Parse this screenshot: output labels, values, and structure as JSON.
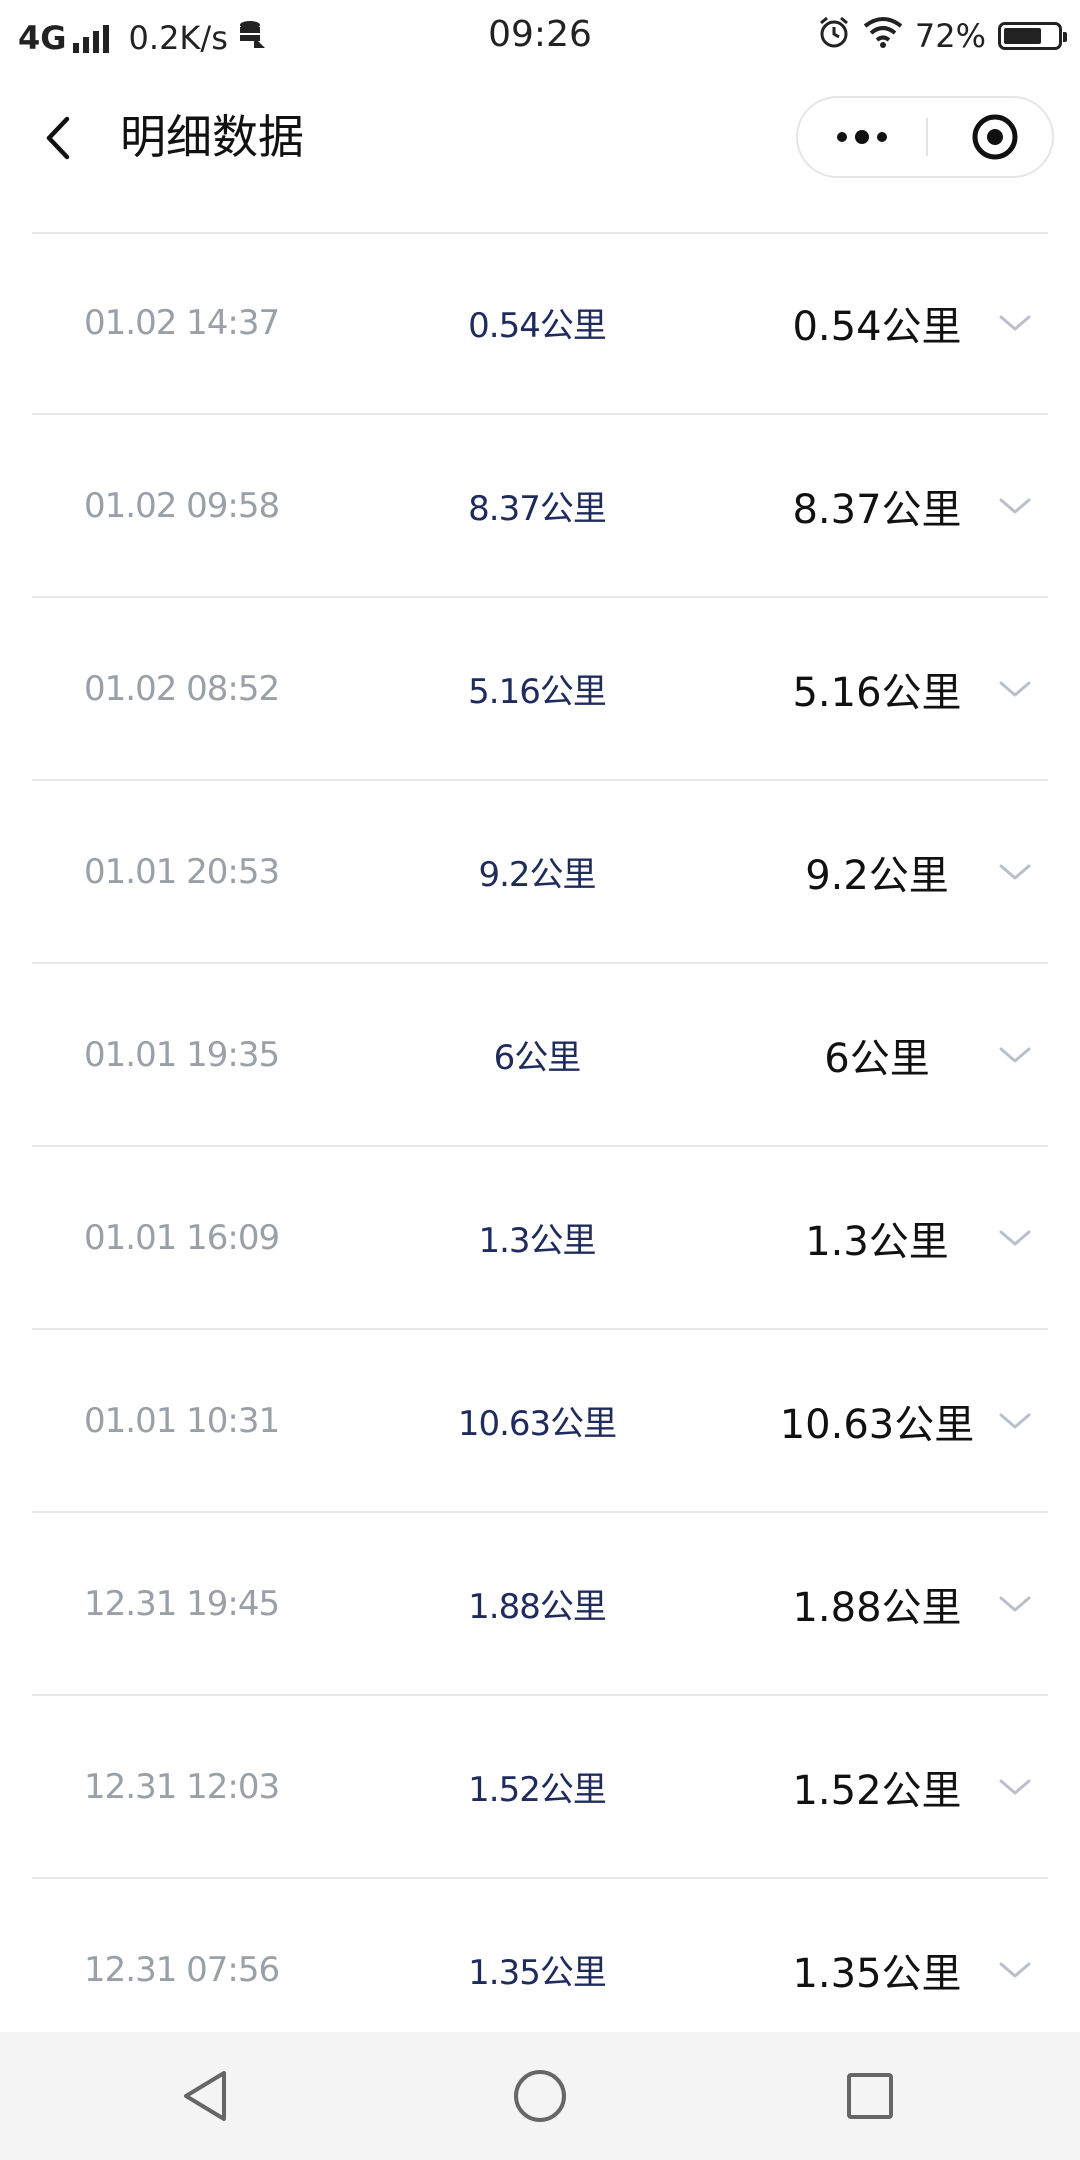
{
  "status_bar": {
    "network": "4G",
    "speed": "0.2K/s",
    "time": "09:26",
    "battery_text": "72%",
    "battery_level": 0.72,
    "icons": [
      "signal-icon",
      "data-icon",
      "alarm-icon",
      "wifi-icon",
      "battery-icon"
    ]
  },
  "nav": {
    "title": "明细数据",
    "back_icon": "chevron-left-icon",
    "more_icon": "more-dots-icon",
    "close_icon": "target-circle-icon"
  },
  "records": [
    {
      "time": "01.02 14:37",
      "distance": "0.54公里",
      "distance_detail": "0.54公里"
    },
    {
      "time": "01.02 09:58",
      "distance": "8.37公里",
      "distance_detail": "8.37公里"
    },
    {
      "time": "01.02 08:52",
      "distance": "5.16公里",
      "distance_detail": "5.16公里"
    },
    {
      "time": "01.01 20:53",
      "distance": "9.2公里",
      "distance_detail": "9.2公里"
    },
    {
      "time": "01.01 19:35",
      "distance": "6公里",
      "distance_detail": "6公里"
    },
    {
      "time": "01.01 16:09",
      "distance": "1.3公里",
      "distance_detail": "1.3公里"
    },
    {
      "time": "01.01 10:31",
      "distance": "10.63公里",
      "distance_detail": "10.63公里"
    },
    {
      "time": "12.31 19:45",
      "distance": "1.88公里",
      "distance_detail": "1.88公里"
    },
    {
      "time": "12.31 12:03",
      "distance": "1.52公里",
      "distance_detail": "1.52公里"
    },
    {
      "time": "12.31 07:56",
      "distance": "1.35公里",
      "distance_detail": "1.35公里"
    }
  ],
  "system_nav": {
    "back_icon": "triangle-back-icon",
    "home_icon": "circle-home-icon",
    "recents_icon": "square-recents-icon"
  },
  "colors": {
    "time_text": "#9aa0a8",
    "distance_text": "#1f2b5c",
    "detail_text": "#111111",
    "divider": "#e8e8e8",
    "chevron": "#b9c0cc"
  }
}
